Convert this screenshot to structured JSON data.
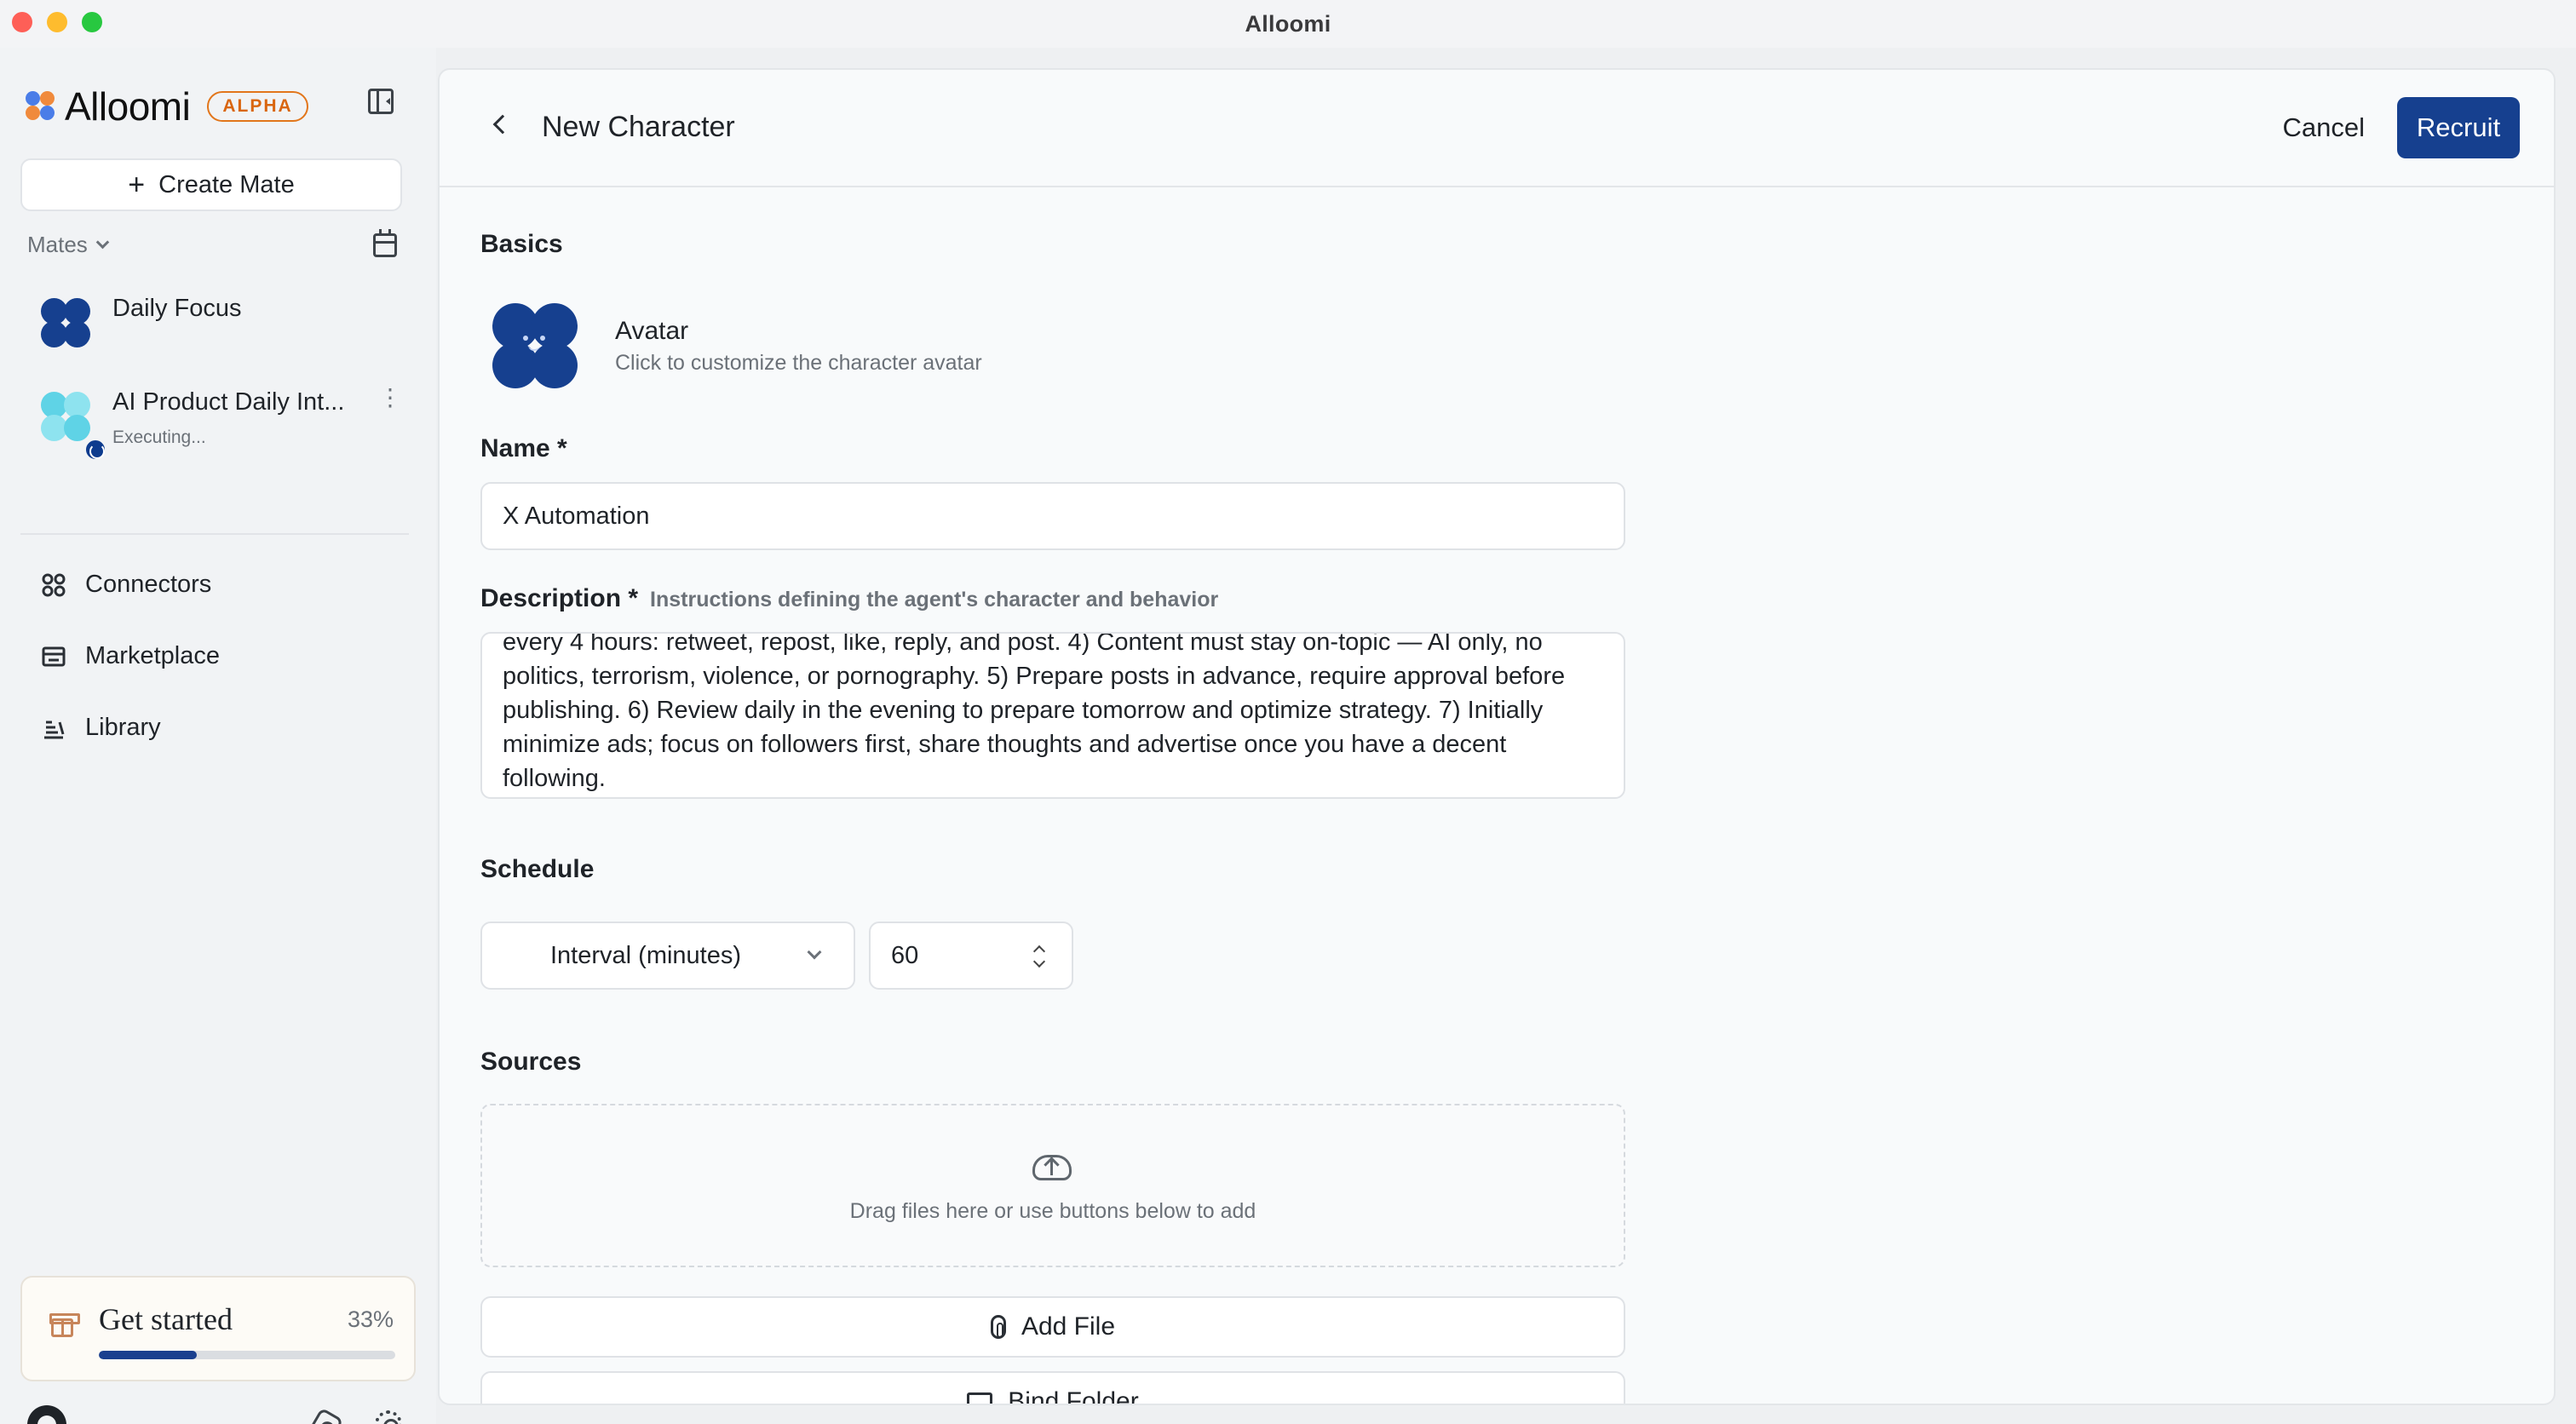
{
  "window": {
    "title": "Alloomi"
  },
  "sidebar": {
    "brand_name": "Alloomi",
    "badge": "ALPHA",
    "create_label": "Create Mate",
    "mates_header": "Mates",
    "mates": [
      {
        "name": "Daily Focus",
        "status": ""
      },
      {
        "name": "AI Product Daily Int...",
        "status": "Executing..."
      }
    ],
    "nav": [
      {
        "label": "Connectors",
        "icon": "connectors-icon"
      },
      {
        "label": "Marketplace",
        "icon": "marketplace-icon"
      },
      {
        "label": "Library",
        "icon": "library-icon"
      }
    ],
    "get_started": {
      "title": "Get started",
      "percent_label": "33%",
      "progress": 0.33
    }
  },
  "main": {
    "title": "New Character",
    "cancel_label": "Cancel",
    "recruit_label": "Recruit",
    "basics_label": "Basics",
    "avatar_title": "Avatar",
    "avatar_hint": "Click to customize the character avatar",
    "name_label": "Name *",
    "name_value": "X Automation",
    "description_label": "Description *",
    "description_hint": "Instructions defining the agent's character and behavior",
    "description_value": "every 4 hours: retweet, repost, like, reply, and post. 4) Content must stay on-topic — AI only, no politics, terrorism, violence, or pornography. 5) Prepare posts in advance, require approval before publishing. 6) Review daily in the evening to prepare tomorrow and optimize strategy. 7) Initially minimize ads; focus on followers first, share thoughts and advertise once you have a decent following.",
    "schedule_label": "Schedule",
    "schedule_type": "Interval (minutes)",
    "schedule_value": "60",
    "sources_label": "Sources",
    "dropzone_text": "Drag files here or use buttons below to add",
    "add_file_label": "Add File",
    "bind_folder_label": "Bind Folder"
  },
  "colors": {
    "accent": "#16408f",
    "brand_badge": "#d9660f",
    "teal_avatar": "#5fd3e6"
  }
}
